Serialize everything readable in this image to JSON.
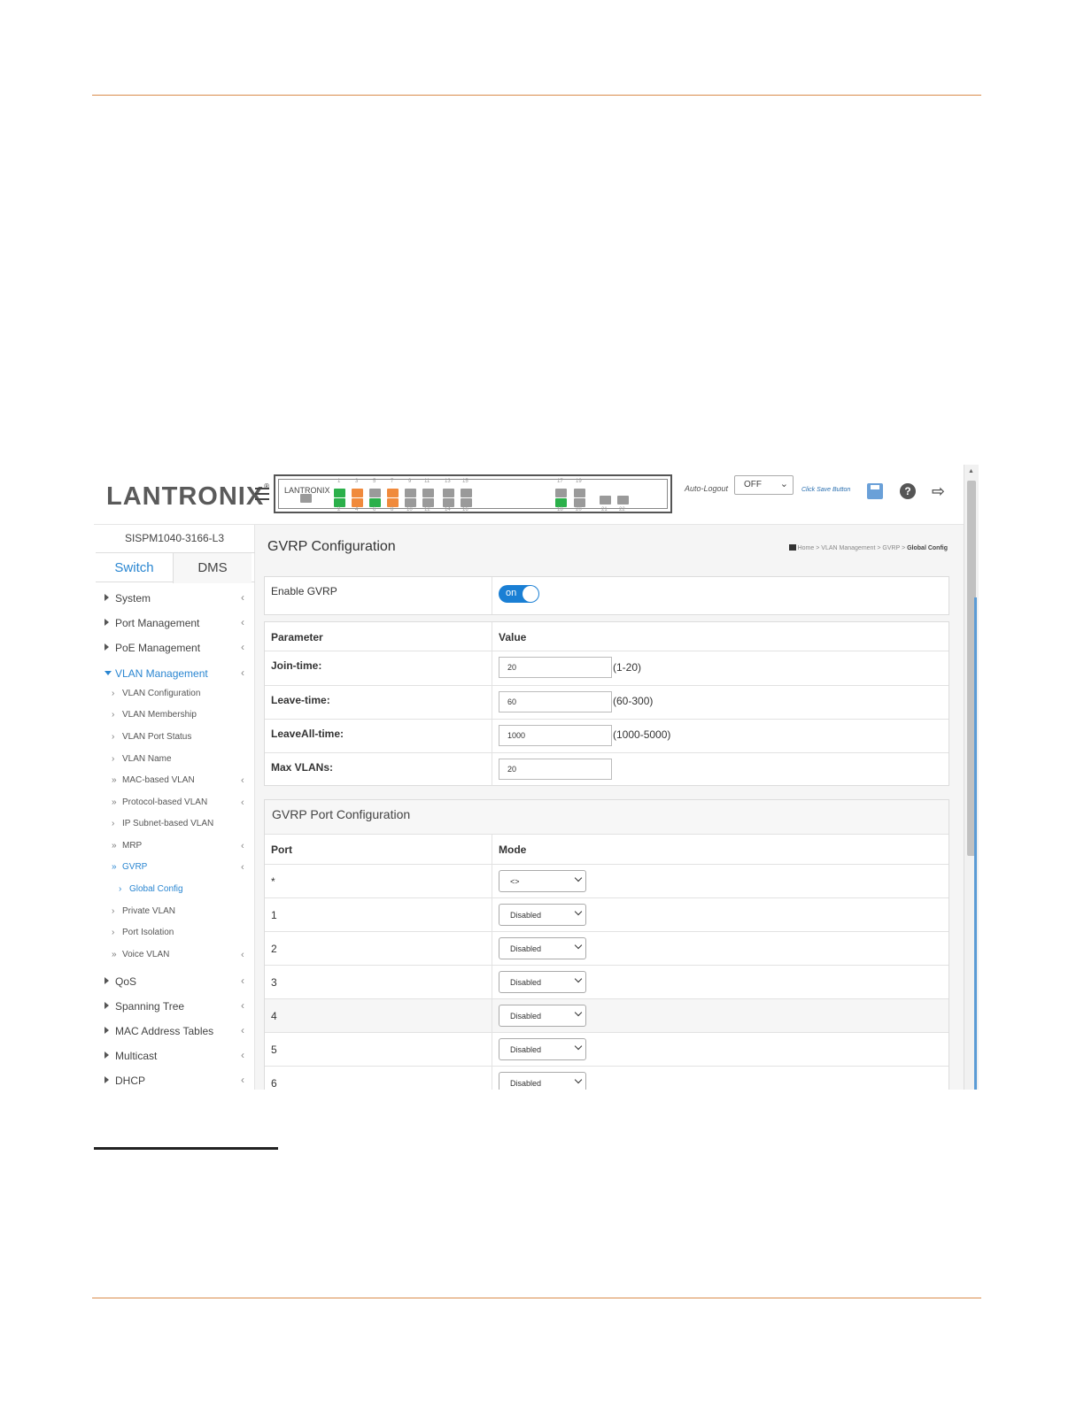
{
  "header": {
    "logo_text": "LANTRONIX",
    "logo_mark": "®",
    "panel_brand": "LANTRONIX",
    "auto_logout_label": "Auto-Logout",
    "auto_logout_value": "OFF",
    "save_hint": "Click Save Button",
    "icons": [
      "menu-icon",
      "save-icon",
      "help-icon",
      "logout-icon"
    ],
    "port_labels_top": [
      "1",
      "3",
      "5",
      "7",
      "9",
      "11",
      "13",
      "15",
      "17",
      "19"
    ],
    "port_labels_bottom": [
      "2",
      "4",
      "6",
      "8",
      "10",
      "12",
      "14",
      "16",
      "18",
      "20",
      "21",
      "22"
    ]
  },
  "sidebar": {
    "model": "SISPM1040-3166-L3",
    "tabs": [
      "Switch",
      "DMS"
    ],
    "items": [
      {
        "label": "System"
      },
      {
        "label": "Port Management"
      },
      {
        "label": "PoE Management"
      },
      {
        "label": "VLAN Management"
      },
      {
        "label": "QoS"
      },
      {
        "label": "Spanning Tree"
      },
      {
        "label": "MAC Address Tables"
      },
      {
        "label": "Multicast"
      },
      {
        "label": "DHCP"
      }
    ],
    "vlan_sub": [
      {
        "label": "VLAN Configuration"
      },
      {
        "label": "VLAN Membership"
      },
      {
        "label": "VLAN Port Status"
      },
      {
        "label": "VLAN Name"
      },
      {
        "label": "MAC-based VLAN"
      },
      {
        "label": "Protocol-based VLAN"
      },
      {
        "label": "IP Subnet-based VLAN"
      },
      {
        "label": "MRP"
      },
      {
        "label": "GVRP"
      },
      {
        "label": "Global Config"
      },
      {
        "label": "Private VLAN"
      },
      {
        "label": "Port Isolation"
      },
      {
        "label": "Voice VLAN"
      }
    ]
  },
  "main": {
    "title": "GVRP Configuration",
    "breadcrumb": [
      "Home",
      "VLAN Management",
      "GVRP",
      "Global Config"
    ],
    "breadcrumb_sep": ">",
    "enable_label": "Enable GVRP",
    "enable_state": "on",
    "param_header": "Parameter",
    "value_header": "Value",
    "params": [
      {
        "label": "Join-time:",
        "value": "20",
        "range": "(1-20)"
      },
      {
        "label": "Leave-time:",
        "value": "60",
        "range": "(60-300)"
      },
      {
        "label": "LeaveAll-time:",
        "value": "1000",
        "range": "(1000-5000)"
      },
      {
        "label": "Max VLANs:",
        "value": "20",
        "range": ""
      }
    ],
    "port_config_title": "GVRP Port Configuration",
    "port_header": "Port",
    "mode_header": "Mode",
    "ports": [
      {
        "port": "*",
        "mode": "<>"
      },
      {
        "port": "1",
        "mode": "Disabled"
      },
      {
        "port": "2",
        "mode": "Disabled"
      },
      {
        "port": "3",
        "mode": "Disabled"
      },
      {
        "port": "4",
        "mode": "Disabled"
      },
      {
        "port": "5",
        "mode": "Disabled"
      },
      {
        "port": "6",
        "mode": "Disabled"
      }
    ]
  },
  "colors": {
    "accent": "#2a86d1",
    "rule": "#d98b4a",
    "brand_x": "#e8452c",
    "port_green": "#2bb04a",
    "port_orange": "#f08a3c"
  }
}
